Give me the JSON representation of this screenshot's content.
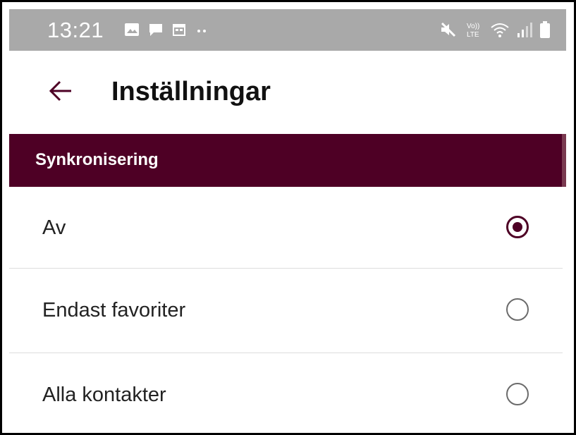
{
  "status_bar": {
    "time": "13:21",
    "left_icons": [
      "gallery-icon",
      "message-icon",
      "calendar-icon",
      "more-dots-icon"
    ],
    "right_icons": [
      "mute-icon",
      "volte-icon",
      "wifi-icon",
      "signal-icon",
      "battery-icon"
    ],
    "volte_label": "Vo))\nLTE"
  },
  "app_bar": {
    "back_icon": "arrow-left-icon",
    "title": "Inställningar",
    "accent_color": "#4e0025"
  },
  "section": {
    "label": "Synkronisering",
    "background_color": "#4e0025"
  },
  "options": [
    {
      "label": "Av",
      "selected": true
    },
    {
      "label": "Endast favoriter",
      "selected": false
    },
    {
      "label": "Alla kontakter",
      "selected": false
    }
  ]
}
